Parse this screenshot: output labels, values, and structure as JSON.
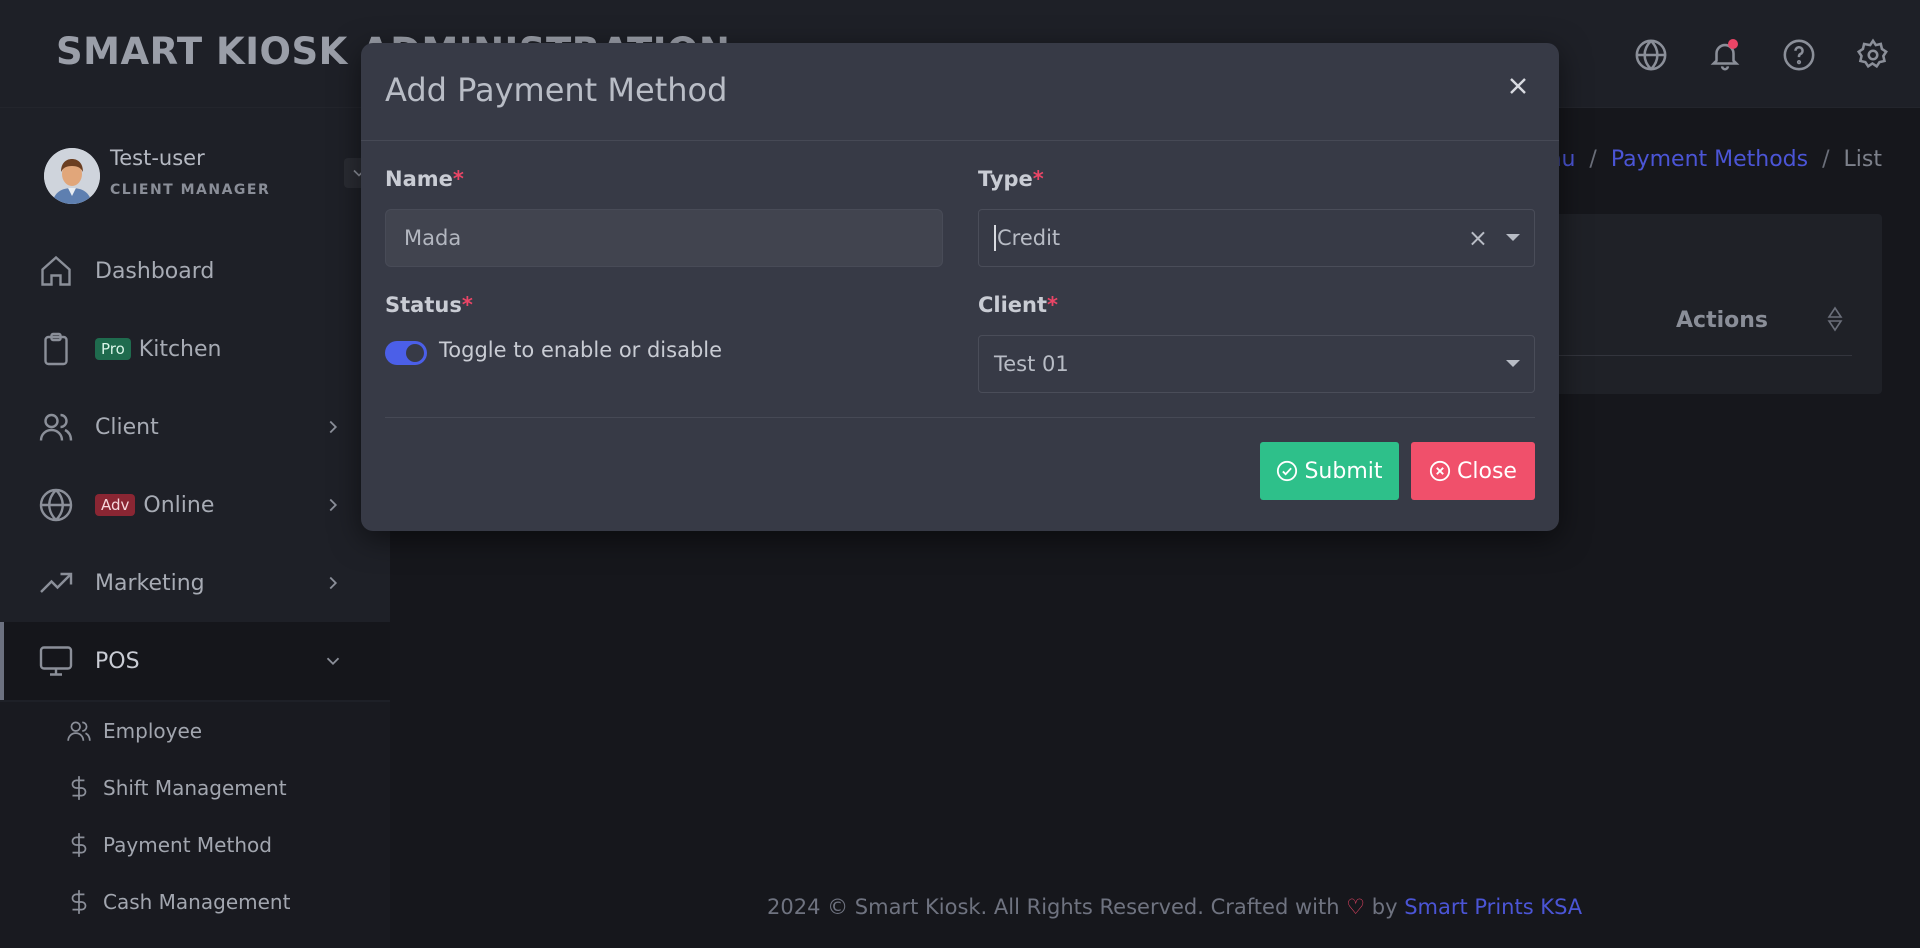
{
  "header": {
    "brand": "SMART KIOSK ADMINISTRATION"
  },
  "user": {
    "name": "Test-user",
    "role": "CLIENT MANAGER"
  },
  "sidebar": {
    "items": [
      {
        "label": "Dashboard"
      },
      {
        "label": "Kitchen",
        "badge": "Pro"
      },
      {
        "label": "Client"
      },
      {
        "label": "Online",
        "badge": "Adv"
      },
      {
        "label": "Marketing"
      },
      {
        "label": "POS"
      }
    ],
    "pos_sub_items": [
      {
        "label": "Employee"
      },
      {
        "label": "Shift Management"
      },
      {
        "label": "Payment Method"
      },
      {
        "label": "Cash Management"
      }
    ]
  },
  "breadcrumb": {
    "items": [
      "Menu",
      "Payment Methods",
      "List"
    ],
    "separator": "/"
  },
  "table": {
    "actions_header": "Actions"
  },
  "footer": {
    "text": "2024 © Smart Kiosk. All Rights Reserved. Crafted with",
    "by": "by",
    "link": "Smart Prints KSA"
  },
  "modal": {
    "title": "Add Payment Method",
    "name_label": "Name",
    "name_value": "Mada",
    "type_label": "Type",
    "type_value": "Credit",
    "status_label": "Status",
    "status_toggle_text": "Toggle to enable or disable",
    "status_enabled": true,
    "client_label": "Client",
    "client_value": "Test 01",
    "required_mark": "*",
    "clear_symbol": "×",
    "submit_label": "Submit",
    "close_label": "Close"
  },
  "colors": {
    "accent": "#4b5fe8",
    "submit": "#2ec08a",
    "close": "#f0506b",
    "required": "#ea4566",
    "link": "#4b55d6"
  }
}
